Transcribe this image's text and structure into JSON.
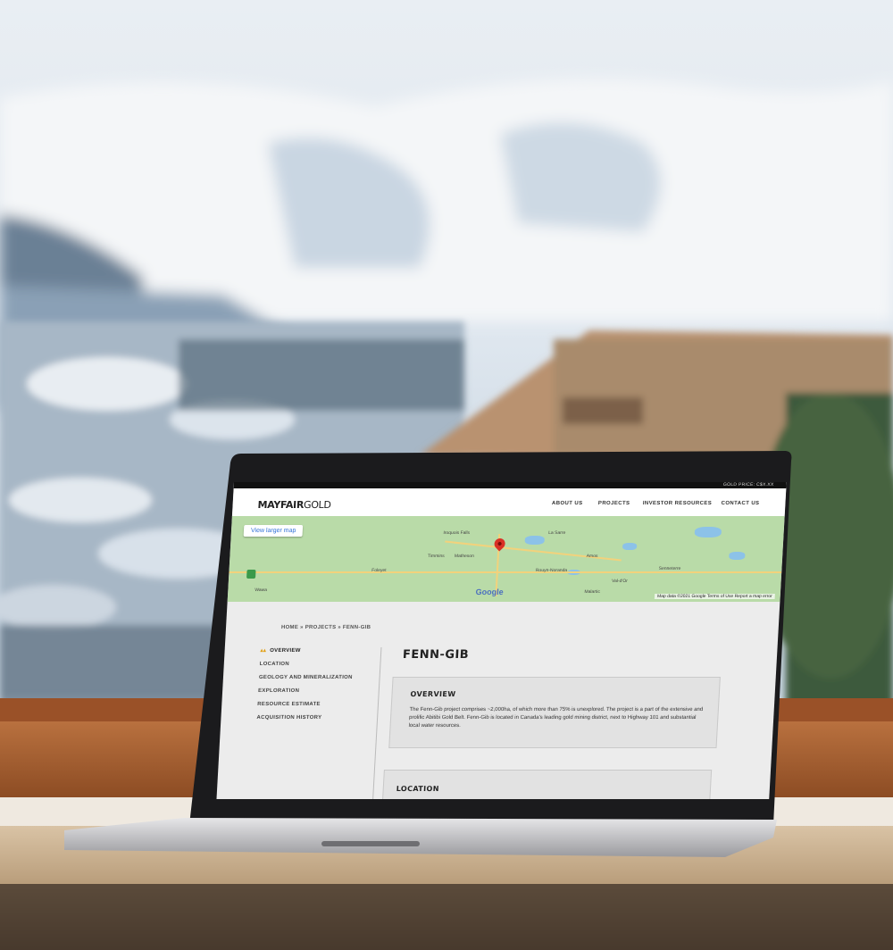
{
  "topbar": {
    "gold_price": "GOLD PRICE: C$X.XX"
  },
  "nav": {
    "logo_bold": "MAYFAIR",
    "logo_light": "GOLD",
    "items": [
      "ABOUT US",
      "PROJECTS",
      "INVESTOR RESOURCES",
      "CONTACT US"
    ]
  },
  "map": {
    "view_larger": "View larger map",
    "labels": [
      "Iroquois Falls",
      "La Sarre",
      "Timmins",
      "Matheson",
      "Foleyet",
      "Rouyn-Noranda",
      "Val-d'Or",
      "Senneterre",
      "Wawa",
      "Amos",
      "Malartic"
    ],
    "google": "Google",
    "footer": "Map data ©2021 Google   Terms of Use   Report a map error"
  },
  "breadcrumb": "HOME » PROJECTS » FENN-GIB",
  "sidebar": {
    "items": [
      {
        "label": "OVERVIEW"
      },
      {
        "label": "LOCATION"
      },
      {
        "label": "GEOLOGY AND MINERALIZATION"
      },
      {
        "label": "EXPLORATION"
      },
      {
        "label": "RESOURCE ESTIMATE"
      },
      {
        "label": "ACQUISITION HISTORY"
      }
    ]
  },
  "main": {
    "title": "FENN-GIB",
    "overview_heading": "OVERVIEW",
    "overview_text": "The Fenn-Gib project comprises ~2,000ha, of which more than 75% is unexplored. The project is a part of the extensive and prolific Abitibi Gold Belt. Fenn-Gib is located in Canada's leading gold mining district, next to Highway 101 and substantial local water resources.",
    "location_heading": "LOCATION"
  }
}
